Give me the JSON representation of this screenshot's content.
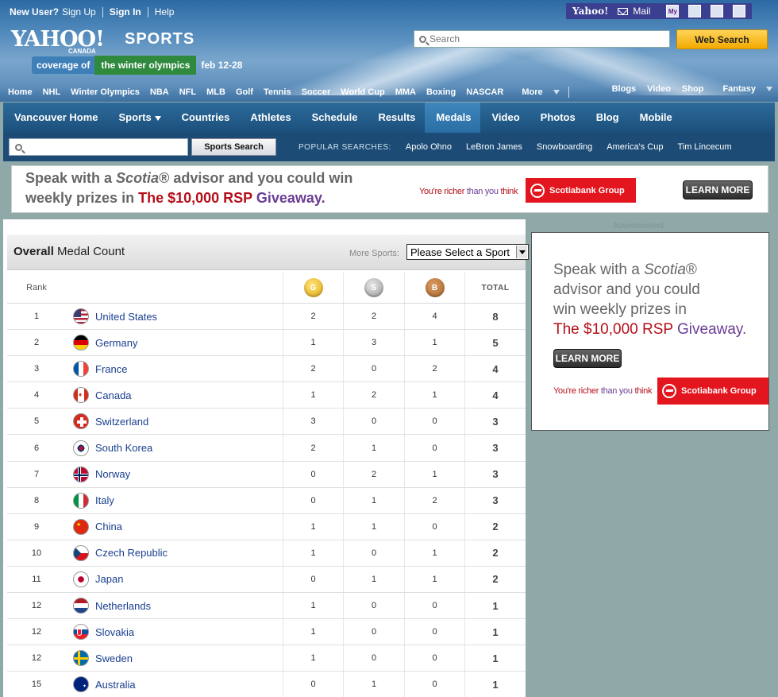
{
  "top_links": {
    "new_user": "New User?",
    "sign_up": "Sign Up",
    "sign_in": "Sign In",
    "help": "Help"
  },
  "services": {
    "yahoo": "Yahoo!",
    "mail": "Mail",
    "my": "My"
  },
  "logo": {
    "yahoo": "YAHOO!",
    "sports": "SPORTS",
    "region": "CANADA"
  },
  "olympics_banner": {
    "part1": "coverage of",
    "part2": "the winter olympics",
    "dates": "feb 12-28"
  },
  "search": {
    "placeholder": "Search",
    "button": "Web Search"
  },
  "sports_nav": [
    "Home",
    "NHL",
    "Winter Olympics",
    "NBA",
    "NFL",
    "MLB",
    "Golf",
    "Tennis",
    "Soccer",
    "World Cup",
    "MMA",
    "Boxing",
    "NASCAR",
    "More"
  ],
  "sports_nav_right": [
    "Blogs",
    "Video",
    "Shop",
    "Fantasy"
  ],
  "olympics_nav": [
    {
      "label": "Vancouver Home",
      "active": false
    },
    {
      "label": "Sports",
      "active": false,
      "dropdown": true
    },
    {
      "label": "Countries",
      "active": false
    },
    {
      "label": "Athletes",
      "active": false
    },
    {
      "label": "Schedule",
      "active": false
    },
    {
      "label": "Results",
      "active": false
    },
    {
      "label": "Medals",
      "active": true
    },
    {
      "label": "Video",
      "active": false
    },
    {
      "label": "Photos",
      "active": false
    },
    {
      "label": "Blog",
      "active": false
    },
    {
      "label": "Mobile",
      "active": false
    }
  ],
  "sports_search": {
    "button": "Sports Search",
    "popular_label": "POPULAR SEARCHES:",
    "popular": [
      "Apolo Ohno",
      "LeBron James",
      "Snowboarding",
      "America's Cup",
      "Tim Lincecum"
    ]
  },
  "banner_ad": {
    "line1_a": "Speak with a ",
    "line1_scotia": "Scotia",
    "line1_b": "® advisor and you could win",
    "line2_a": "weekly prizes in ",
    "line2_the": "The ",
    "line2_money": "$10,000 RSP ",
    "line2_give": "Giveaway.",
    "richer": "You're richer ",
    "than_you": "than you",
    "think": " think",
    "brand": "Scotiabank Group",
    "cta": "LEARN MORE"
  },
  "medal_panel": {
    "title_bold": "Overall",
    "title_rest": " Medal Count",
    "more_sports_label": "More Sports:",
    "select_value": "Please Select a Sport",
    "headers": {
      "rank": "Rank",
      "gold": "G",
      "silver": "S",
      "bronze": "B",
      "total": "TOTAL"
    },
    "colors": {
      "gold": "#e0a912",
      "silver": "#9a9a9a",
      "bronze": "#a8672c"
    },
    "rows": [
      {
        "rank": "1",
        "country": "United States",
        "g": "2",
        "s": "2",
        "b": "4",
        "t": "8",
        "flag": "us"
      },
      {
        "rank": "2",
        "country": "Germany",
        "g": "1",
        "s": "3",
        "b": "1",
        "t": "5",
        "flag": "de"
      },
      {
        "rank": "3",
        "country": "France",
        "g": "2",
        "s": "0",
        "b": "2",
        "t": "4",
        "flag": "fr"
      },
      {
        "rank": "4",
        "country": "Canada",
        "g": "1",
        "s": "2",
        "b": "1",
        "t": "4",
        "flag": "ca"
      },
      {
        "rank": "5",
        "country": "Switzerland",
        "g": "3",
        "s": "0",
        "b": "0",
        "t": "3",
        "flag": "ch"
      },
      {
        "rank": "6",
        "country": "South Korea",
        "g": "2",
        "s": "1",
        "b": "0",
        "t": "3",
        "flag": "kr"
      },
      {
        "rank": "7",
        "country": "Norway",
        "g": "0",
        "s": "2",
        "b": "1",
        "t": "3",
        "flag": "no"
      },
      {
        "rank": "8",
        "country": "Italy",
        "g": "0",
        "s": "1",
        "b": "2",
        "t": "3",
        "flag": "it"
      },
      {
        "rank": "9",
        "country": "China",
        "g": "1",
        "s": "1",
        "b": "0",
        "t": "2",
        "flag": "cn"
      },
      {
        "rank": "10",
        "country": "Czech Republic",
        "g": "1",
        "s": "0",
        "b": "1",
        "t": "2",
        "flag": "cz"
      },
      {
        "rank": "11",
        "country": "Japan",
        "g": "0",
        "s": "1",
        "b": "1",
        "t": "2",
        "flag": "jp"
      },
      {
        "rank": "12",
        "country": "Netherlands",
        "g": "1",
        "s": "0",
        "b": "0",
        "t": "1",
        "flag": "nl"
      },
      {
        "rank": "12",
        "country": "Slovakia",
        "g": "1",
        "s": "0",
        "b": "0",
        "t": "1",
        "flag": "sk"
      },
      {
        "rank": "12",
        "country": "Sweden",
        "g": "1",
        "s": "0",
        "b": "0",
        "t": "1",
        "flag": "se"
      },
      {
        "rank": "15",
        "country": "Australia",
        "g": "0",
        "s": "1",
        "b": "0",
        "t": "1",
        "flag": "au"
      }
    ]
  },
  "side_ad": {
    "label": "Advertisement",
    "l1a": "Speak with a ",
    "l1b": "Scotia",
    "l1c": "®",
    "l2": "advisor and you could",
    "l3": "win weekly prizes in",
    "l4a": "The ",
    "l4b": "$10,000 RSP ",
    "l4c": "Giveaway.",
    "cta": "LEARN MORE",
    "richer": "You're richer ",
    "than_you": "than you",
    "think": " think",
    "brand": "Scotiabank Group"
  }
}
